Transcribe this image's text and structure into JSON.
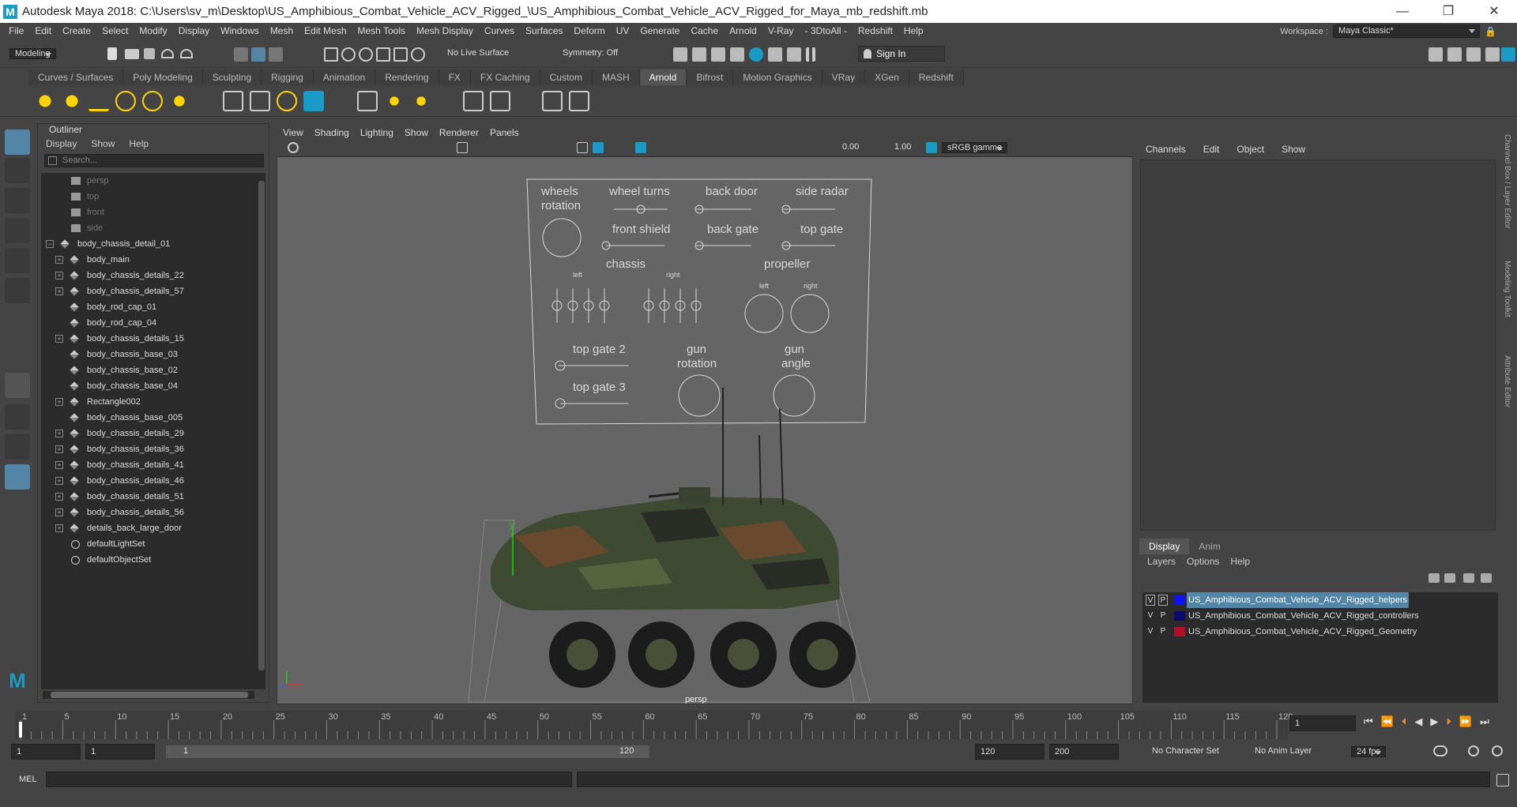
{
  "window": {
    "title": "Autodesk Maya 2018: C:\\Users\\sv_m\\Desktop\\US_Amphibious_Combat_Vehicle_ACV_Rigged_\\US_Amphibious_Combat_Vehicle_ACV_Rigged_for_Maya_mb_redshift.mb",
    "logo": "M",
    "min": "—",
    "restore": "❐",
    "close": "✕"
  },
  "menubar": {
    "items": [
      "File",
      "Edit",
      "Create",
      "Select",
      "Modify",
      "Display",
      "Windows",
      "Mesh",
      "Edit Mesh",
      "Mesh Tools",
      "Mesh Display",
      "Curves",
      "Surfaces",
      "Deform",
      "UV",
      "Generate",
      "Cache",
      "Arnold",
      "V-Ray",
      "- 3DtoAll -",
      "Redshift",
      "Help"
    ],
    "workspace_label": "Workspace :",
    "workspace_value": "Maya Classic*"
  },
  "statusline": {
    "mode": "Modeling",
    "live_surface": "No Live Surface",
    "symmetry": "Symmetry: Off",
    "sign_in": "Sign In"
  },
  "shelf": {
    "tabs": [
      "Curves / Surfaces",
      "Poly Modeling",
      "Sculpting",
      "Rigging",
      "Animation",
      "Rendering",
      "FX",
      "FX Caching",
      "Custom",
      "MASH",
      "Arnold",
      "Bifrost",
      "Motion Graphics",
      "VRay",
      "XGen",
      "Redshift"
    ],
    "active_tab": "Arnold"
  },
  "outliner": {
    "title": "Outliner",
    "menu": [
      "Display",
      "Show",
      "Help"
    ],
    "search_placeholder": "Search...",
    "items": [
      {
        "label": "persp",
        "kind": "camera",
        "dim": true,
        "expand": false
      },
      {
        "label": "top",
        "kind": "camera",
        "dim": true,
        "expand": false
      },
      {
        "label": "front",
        "kind": "camera",
        "dim": true,
        "expand": false
      },
      {
        "label": "side",
        "kind": "camera",
        "dim": true,
        "expand": false
      },
      {
        "label": "body_chassis_detail_01",
        "kind": "mesh",
        "dim": false,
        "expand": true,
        "root": true
      },
      {
        "label": "body_main",
        "kind": "mesh",
        "dim": false,
        "expand": true
      },
      {
        "label": "body_chassis_details_22",
        "kind": "mesh",
        "dim": false,
        "expand": true
      },
      {
        "label": "body_chassis_details_57",
        "kind": "mesh",
        "dim": false,
        "expand": true
      },
      {
        "label": "body_rod_cap_01",
        "kind": "mesh",
        "dim": false,
        "expand": false
      },
      {
        "label": "body_rod_cap_04",
        "kind": "mesh",
        "dim": false,
        "expand": false
      },
      {
        "label": "body_chassis_details_15",
        "kind": "mesh",
        "dim": false,
        "expand": true
      },
      {
        "label": "body_chassis_base_03",
        "kind": "mesh",
        "dim": false,
        "expand": false
      },
      {
        "label": "body_chassis_base_02",
        "kind": "mesh",
        "dim": false,
        "expand": false
      },
      {
        "label": "body_chassis_base_04",
        "kind": "mesh",
        "dim": false,
        "expand": false
      },
      {
        "label": "Rectangle002",
        "kind": "mesh",
        "dim": false,
        "expand": true
      },
      {
        "label": "body_chassis_base_005",
        "kind": "mesh",
        "dim": false,
        "expand": false
      },
      {
        "label": "body_chassis_details_29",
        "kind": "mesh",
        "dim": false,
        "expand": true
      },
      {
        "label": "body_chassis_details_36",
        "kind": "mesh",
        "dim": false,
        "expand": true
      },
      {
        "label": "body_chassis_details_41",
        "kind": "mesh",
        "dim": false,
        "expand": true
      },
      {
        "label": "body_chassis_details_46",
        "kind": "mesh",
        "dim": false,
        "expand": true
      },
      {
        "label": "body_chassis_details_51",
        "kind": "mesh",
        "dim": false,
        "expand": true
      },
      {
        "label": "body_chassis_details_56",
        "kind": "mesh",
        "dim": false,
        "expand": true
      },
      {
        "label": "details_back_large_door",
        "kind": "mesh",
        "dim": false,
        "expand": true
      },
      {
        "label": "defaultLightSet",
        "kind": "set",
        "dim": false,
        "expand": false
      },
      {
        "label": "defaultObjectSet",
        "kind": "set",
        "dim": false,
        "expand": false
      }
    ]
  },
  "viewport": {
    "menu": [
      "View",
      "Shading",
      "Lighting",
      "Show",
      "Renderer",
      "Panels"
    ],
    "exposure": "0.00",
    "gamma": "1.00",
    "color_space": "sRGB gamma",
    "camera_label": "persp",
    "axis_y": "y",
    "controls": {
      "wheels_rotation": "wheels\nrotation",
      "wheel_turns": "wheel turns",
      "back_door": "back door",
      "side_radar": "side radar",
      "front_shield": "front shield",
      "back_gate": "back gate",
      "top_gate": "top gate",
      "chassis": "chassis",
      "left": "left",
      "right": "right",
      "propeller": "propeller",
      "top_gate_2": "top gate 2",
      "top_gate_3": "top gate 3",
      "gun_rotation": "gun\nrotation",
      "gun_angle": "gun\nangle"
    }
  },
  "channelbox": {
    "menu": [
      "Channels",
      "Edit",
      "Object",
      "Show"
    ],
    "side_tabs": [
      "Channel Box / Layer Editor",
      "Modeling Toolkit",
      "Attribute Editor"
    ]
  },
  "layers": {
    "tabs": [
      "Display",
      "Anim"
    ],
    "active_tab": "Display",
    "menu": [
      "Layers",
      "Options",
      "Help"
    ],
    "rows": [
      {
        "v": "V",
        "p": "P",
        "color": "#1010ff",
        "name": "US_Amphibious_Combat_Vehicle_ACV_Rigged_helpers",
        "selected": true
      },
      {
        "v": "V",
        "p": "P",
        "color": "#0a0a6a",
        "name": "US_Amphibious_Combat_Vehicle_ACV_Rigged_controllers",
        "selected": false
      },
      {
        "v": "V",
        "p": "P",
        "color": "#b0102a",
        "name": "US_Amphibious_Combat_Vehicle_ACV_Rigged_Geometry",
        "selected": false
      }
    ]
  },
  "timeline": {
    "ticks": [
      "1",
      "5",
      "10",
      "15",
      "20",
      "25",
      "30",
      "35",
      "40",
      "45",
      "50",
      "55",
      "60",
      "65",
      "70",
      "75",
      "80",
      "85",
      "90",
      "95",
      "100",
      "105",
      "110",
      "115",
      "120"
    ],
    "current_frame": "1",
    "range_start": "1",
    "range_inner_start": "1",
    "range_slider_start": "1",
    "range_slider_end": "120",
    "range_end": "120",
    "anim_end": "200",
    "character_set": "No Character Set",
    "anim_layer": "No Anim Layer",
    "fps": "24 fps"
  },
  "commandline": {
    "label": "MEL"
  },
  "colors": {
    "bg": "#444444",
    "panel": "#2b2b2b",
    "viewport": "#656565",
    "selection": "#5285a6",
    "maya_blue": "#1a9bc5"
  }
}
